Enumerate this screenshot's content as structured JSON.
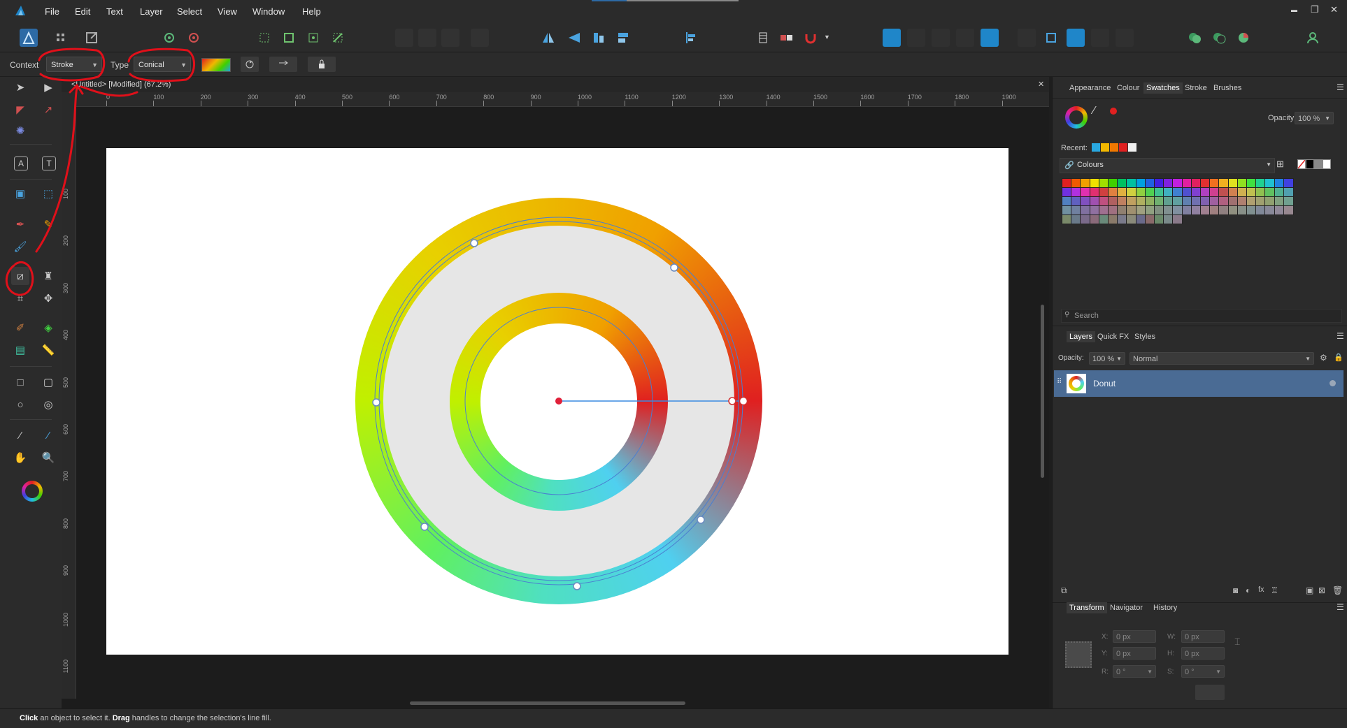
{
  "menu": {
    "items": [
      "File",
      "Edit",
      "Text",
      "Layer",
      "Select",
      "View",
      "Window",
      "Help"
    ]
  },
  "window_controls": {
    "minimize": "▬",
    "restore": "❐",
    "close": "✕"
  },
  "context_bar": {
    "context_label": "Context",
    "context_value": "Stroke",
    "type_label": "Type",
    "type_value": "Conical"
  },
  "document": {
    "tab_title": "<Untitled> [Modified] (67.2%)",
    "close_glyph": "✕",
    "ruler_top": [
      "0",
      "100",
      "200",
      "300",
      "400",
      "500",
      "600",
      "700",
      "800",
      "900",
      "1000",
      "1100",
      "1200",
      "1300",
      "1400",
      "1500",
      "1600",
      "1700",
      "1800",
      "1900"
    ],
    "ruler_left": [
      "100",
      "200",
      "300",
      "400",
      "500",
      "600",
      "700",
      "800",
      "900",
      "1000",
      "1100"
    ]
  },
  "right_panel": {
    "top_tabs": [
      "Appearance",
      "Colour",
      "Swatches",
      "Stroke",
      "Brushes"
    ],
    "active_top_tab": "Swatches",
    "opacity_label": "Opacity:",
    "opacity_value": "100 %",
    "recent_label": "Recent:",
    "palette_name": "Colours",
    "search_placeholder": "Search",
    "layer_tabs": [
      "Layers",
      "Quick FX",
      "Styles"
    ],
    "layers_opacity_label": "Opacity:",
    "layers_opacity_value": "100 %",
    "blend_mode": "Normal",
    "layer_name": "Donut",
    "bottom_tabs": [
      "Transform",
      "Navigator",
      "History"
    ],
    "transform": {
      "x_label": "X:",
      "x_value": "0 px",
      "y_label": "Y:",
      "y_value": "0 px",
      "w_label": "W:",
      "w_value": "0 px",
      "h_label": "H:",
      "h_value": "0 px",
      "r_label": "R:",
      "r_value": "0 °",
      "s_label": "S:",
      "s_value": "0 °"
    }
  },
  "recent_colors": [
    "#29a8e0",
    "#f2b800",
    "#f07800",
    "#e02020",
    "#f0f0f0"
  ],
  "swatch_rows": [
    [
      "#e02020",
      "#f05a00",
      "#f0a000",
      "#f0e000",
      "#a0e000",
      "#40d000",
      "#00c060",
      "#00c0a0",
      "#00a0e0",
      "#2060e0",
      "#4020e0",
      "#8020e0",
      "#c020e0",
      "#e020a0",
      "#e02060",
      "#e03030",
      "#f07020",
      "#f0b020",
      "#e0e020",
      "#90e020",
      "#40e040",
      "#20d090",
      "#20c0d0",
      "#2080e0",
      "#4040e0"
    ],
    [
      "#7030e0",
      "#b030e0",
      "#e030b0",
      "#e03070",
      "#d04040",
      "#e08040",
      "#e0b040",
      "#d0d040",
      "#90d040",
      "#50d050",
      "#40c090",
      "#40b0c0",
      "#4080d0",
      "#5050d0",
      "#8040d0",
      "#b040c0",
      "#d04090",
      "#c05050",
      "#d08050",
      "#d0b050",
      "#c0c050",
      "#90c050",
      "#60c060",
      "#50b090",
      "#50a0b0"
    ],
    [
      "#5080c0",
      "#6060c0",
      "#8050c0",
      "#a050b0",
      "#c05080",
      "#b06060",
      "#c08060",
      "#c0a060",
      "#b0b060",
      "#90b060",
      "#70b070",
      "#60a090",
      "#60a0a0",
      "#6080b0",
      "#7070b0",
      "#8060b0",
      "#a060a0",
      "#b06080",
      "#a07070",
      "#b08070",
      "#b0a070",
      "#a0a070",
      "#90a070",
      "#80a080",
      "#70a090"
    ],
    [
      "#7090a0",
      "#7080a0",
      "#8070a0",
      "#9070a0",
      "#a07090",
      "#a07080",
      "#908070",
      "#a09070",
      "#a0a080",
      "#90a080",
      "#809080",
      "#809090",
      "#8090a0",
      "#8080a0",
      "#9080a0",
      "#a08090",
      "#a08080",
      "#908080",
      "#909080",
      "#889088",
      "#809090",
      "#808898",
      "#888898",
      "#908898",
      "#988890"
    ],
    [
      "#7a8a6a",
      "#6a7a8a",
      "#7a6a8a",
      "#8a6a7a",
      "#6a8a7a",
      "#8a7a6a",
      "#7a7a8a",
      "#8a8a7a",
      "#6a6a8a",
      "#8a6a6a",
      "#6a8a6a",
      "#7a8a8a",
      "#8a7a8a"
    ]
  ],
  "status": {
    "click": "Click",
    "text1": " an object to select it. ",
    "drag": "Drag",
    "text2": " handles to change the selection's line fill."
  }
}
